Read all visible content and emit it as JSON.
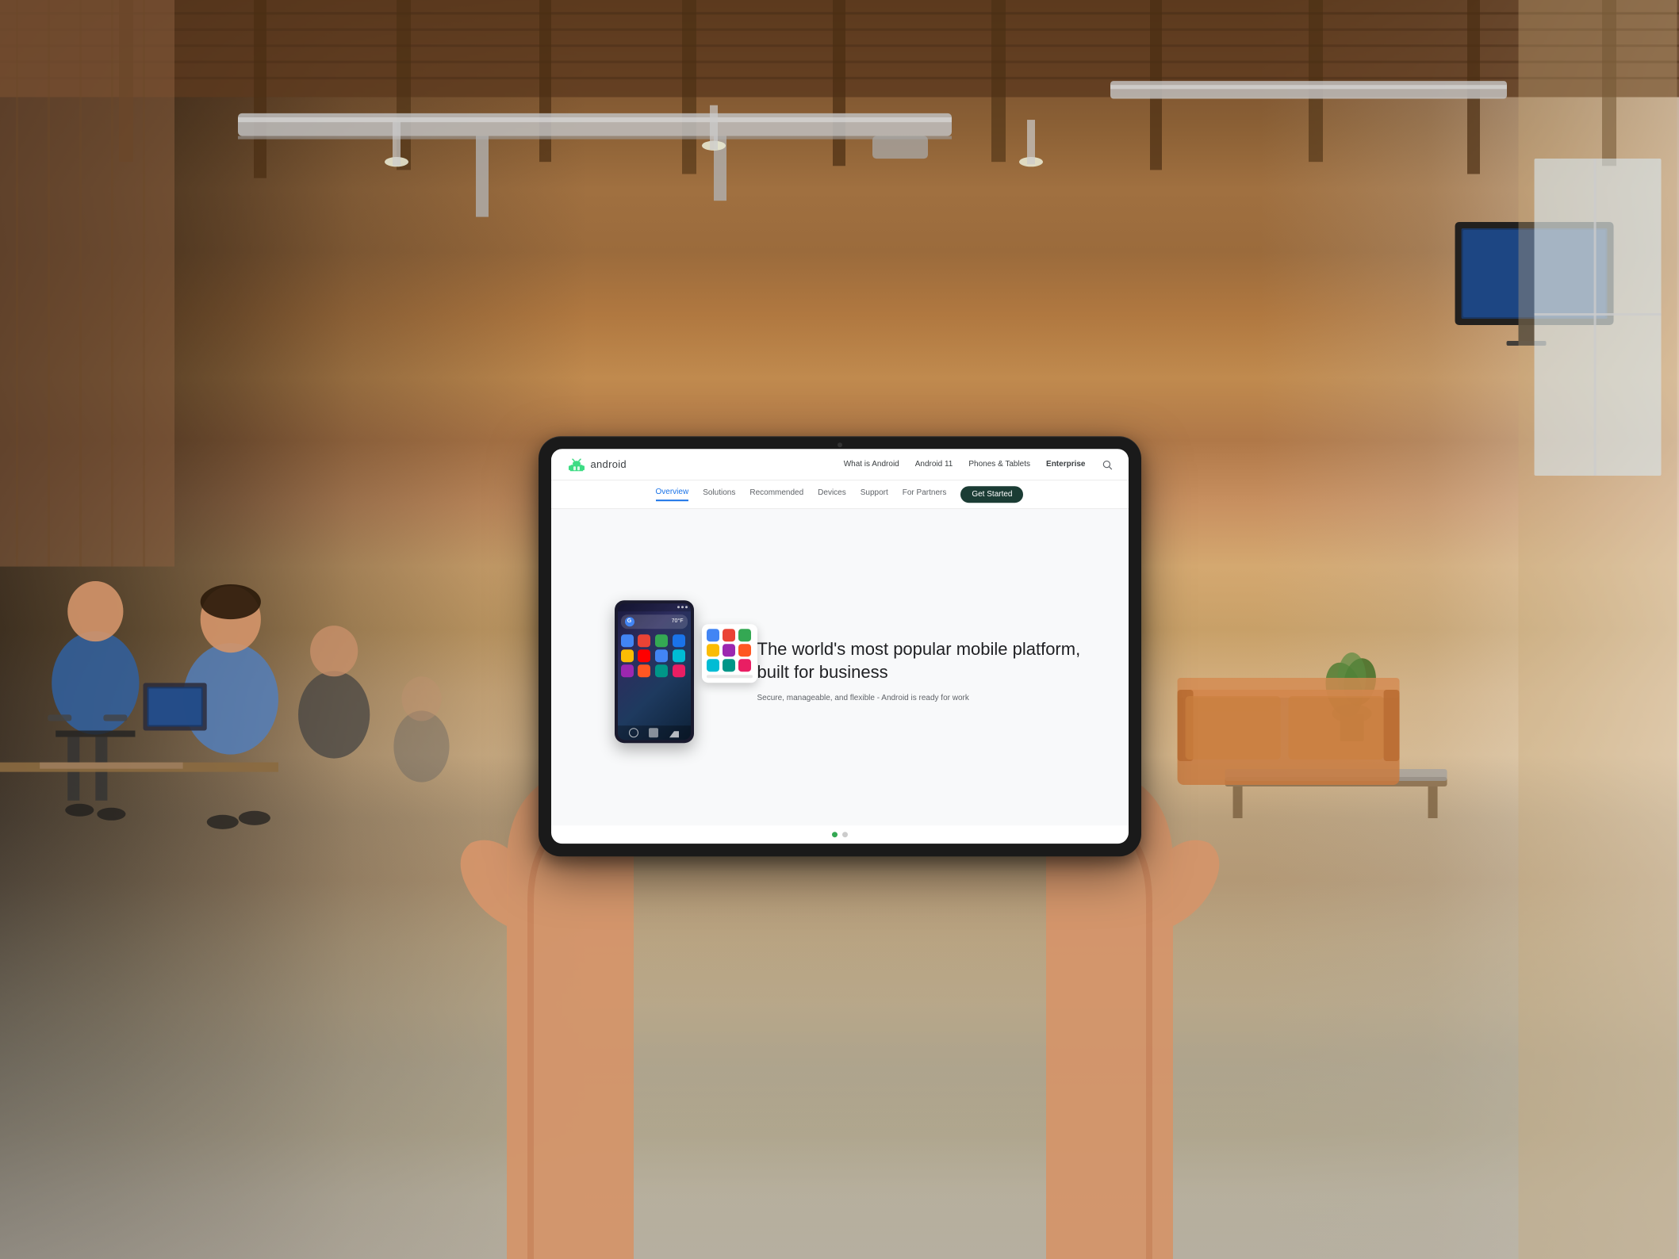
{
  "scene": {
    "background_desc": "Office workspace with wooden ceiling beams, brick walls, people working"
  },
  "tablet": {
    "camera_label": "front camera"
  },
  "website": {
    "logo": {
      "text": "android",
      "icon_color": "#3ddc84"
    },
    "top_nav": {
      "links": [
        {
          "label": "What is Android",
          "active": false
        },
        {
          "label": "Android 11",
          "active": false
        },
        {
          "label": "Phones & Tablets",
          "active": false
        },
        {
          "label": "Enterprise",
          "active": true
        }
      ],
      "search_label": "search"
    },
    "sub_nav": {
      "items": [
        {
          "label": "Overview",
          "active": true
        },
        {
          "label": "Solutions",
          "active": false
        },
        {
          "label": "Recommended",
          "active": false
        },
        {
          "label": "Devices",
          "active": false
        },
        {
          "label": "Support",
          "active": false
        },
        {
          "label": "For Partners",
          "active": false
        }
      ],
      "cta_button": "Get Started"
    },
    "hero": {
      "title": "The world's most popular mobile platform, built for business",
      "subtitle": "Secure, manageable, and flexible - Android is ready for work",
      "dots": [
        {
          "active": true
        },
        {
          "active": false
        }
      ]
    }
  }
}
